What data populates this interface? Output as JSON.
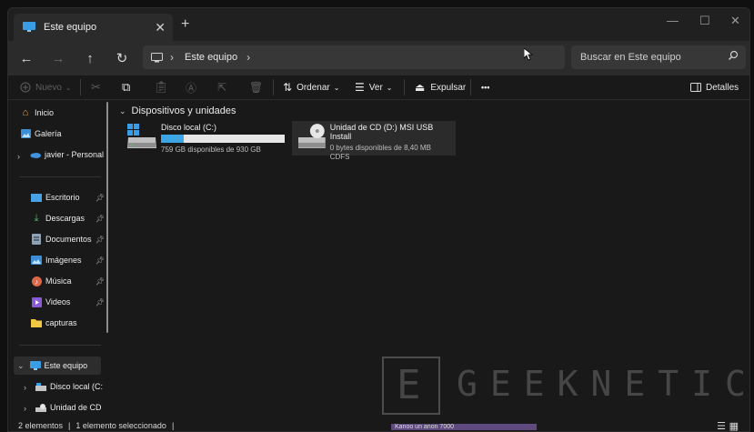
{
  "tab": {
    "title": "Este equipo",
    "close": "✕",
    "new_tab": "+"
  },
  "window_controls": {
    "minimize": "—",
    "maximize": "☐",
    "close": "✕"
  },
  "nav": {
    "back": "←",
    "forward": "→",
    "up": "↑",
    "refresh": "↻",
    "address_chevron": "›",
    "address_crumb": "Este equipo",
    "address_trailing_chevron": "›",
    "search_placeholder": "Buscar en Este equipo"
  },
  "command_bar": {
    "new_label": "Nuevo",
    "sort_label": "Ordenar",
    "view_label": "Ver",
    "eject_label": "Expulsar",
    "more_label": "•••",
    "details_label": "Detalles"
  },
  "sidebar": {
    "items": [
      {
        "label": "Inicio",
        "icon": "home-icon"
      },
      {
        "label": "Galería",
        "icon": "gallery-icon"
      },
      {
        "label": "javier - Personal",
        "icon": "onedrive-icon"
      },
      {
        "label": "Escritorio",
        "icon": "desktop-icon",
        "pinned": true
      },
      {
        "label": "Descargas",
        "icon": "download-icon",
        "pinned": true
      },
      {
        "label": "Documentos",
        "icon": "documents-icon",
        "pinned": true
      },
      {
        "label": "Imágenes",
        "icon": "pictures-icon",
        "pinned": true
      },
      {
        "label": "Música",
        "icon": "music-icon",
        "pinned": true
      },
      {
        "label": "Videos",
        "icon": "videos-icon",
        "pinned": true
      },
      {
        "label": "capturas",
        "icon": "folder-icon"
      },
      {
        "label": "Este equipo",
        "icon": "this-pc-icon"
      },
      {
        "label": "Disco local (C:",
        "icon": "drive-icon"
      },
      {
        "label": "Unidad de CD",
        "icon": "cd-drive-icon"
      }
    ]
  },
  "content": {
    "group_title": "Dispositivos y unidades",
    "drives": [
      {
        "name": "Disco local (C:)",
        "free": "759 GB disponibles de 930 GB",
        "used_fraction": 0.184
      },
      {
        "name": "Unidad de CD (D:) MSI USB Install",
        "free": "0 bytes disponibles de 8,40 MB",
        "fs": "CDFS"
      }
    ]
  },
  "status": {
    "items_count": "2 elementos",
    "separator": "|",
    "selected": "1 elemento seleccionado",
    "separator2": "|"
  },
  "watermark": {
    "letter": "E",
    "text": "GEEKNETIC"
  },
  "bottom_overlay": "Kanoo un anon 7000",
  "colors": {
    "accent": "#3da4e6",
    "window_bg": "#191919",
    "nav_bg": "#2b2b2b"
  }
}
